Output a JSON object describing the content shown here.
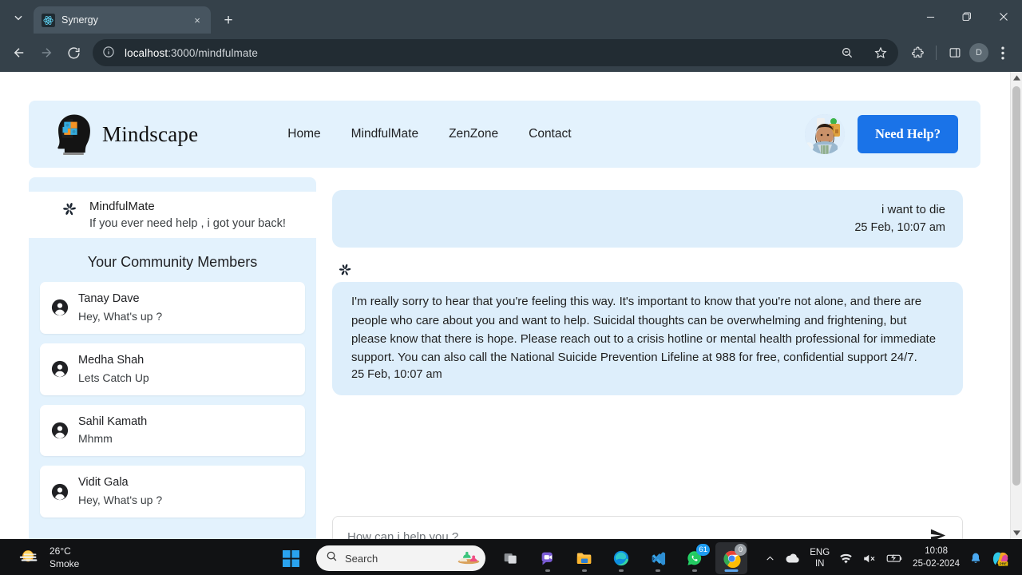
{
  "browser": {
    "tab": {
      "title": "Synergy",
      "favicon": "react-atom-icon",
      "close": "×"
    },
    "new_tab": "+",
    "window_controls": {
      "minimize": "−",
      "restore": "❐",
      "close": "✕"
    },
    "omnibox": {
      "host": "localhost",
      "rest": ":3000/mindfulmate",
      "info_icon": "site-info-icon"
    },
    "profile_initial": "D"
  },
  "site": {
    "brand": "Mindscape",
    "nav": [
      {
        "label": "Home"
      },
      {
        "label": "MindfulMate"
      },
      {
        "label": "ZenZone"
      },
      {
        "label": "Contact"
      }
    ],
    "need_help_label": "Need Help?",
    "accent_color": "#1a73e8",
    "panel_color": "#e3f2fd",
    "bubble_color": "#ddeefb"
  },
  "sidebar": {
    "assistant": {
      "name": "MindfulMate",
      "tagline": "If you ever need help , i got your back!",
      "icon": "pinwheel-sparkle-icon"
    },
    "members_title": "Your Community Members",
    "members": [
      {
        "name": "Tanay Dave",
        "message": "Hey, What's up ?"
      },
      {
        "name": "Medha Shah",
        "message": "Lets Catch Up"
      },
      {
        "name": "Sahil Kamath",
        "message": "Mhmm"
      },
      {
        "name": "Vidit Gala",
        "message": "Hey, What's up ?"
      }
    ]
  },
  "chat": {
    "messages": [
      {
        "role": "user",
        "text": "i want to die",
        "timestamp": "25 Feb, 10:07 am"
      },
      {
        "role": "assistant",
        "text": "I'm really sorry to hear that you're feeling this way. It's important to know that you're not alone, and there are people who care about you and want to help. Suicidal thoughts can be overwhelming and frightening, but please know that there is hope. Please reach out to a crisis hotline or mental health professional for immediate support. You can also call the National Suicide Prevention Lifeline at 988 for free, confidential support 24/7.",
        "timestamp": "25 Feb, 10:07 am"
      }
    ],
    "composer": {
      "placeholder": "How can i help you ?",
      "value": "",
      "send_icon": "send-paper-plane-icon"
    }
  },
  "taskbar": {
    "weather": {
      "temperature": "26°C",
      "condition": "Smoke",
      "icon": "haze-sun-icon"
    },
    "search_placeholder": "Search",
    "apps": [
      {
        "name": "task-view"
      },
      {
        "name": "chat-video"
      },
      {
        "name": "file-explorer"
      },
      {
        "name": "microsoft-edge"
      },
      {
        "name": "vs-code"
      },
      {
        "name": "whatsapp",
        "badge": "61"
      },
      {
        "name": "google-chrome",
        "badge": "0"
      }
    ],
    "tray": {
      "language": "ENG",
      "region": "IN",
      "time": "10:08",
      "date": "25-02-2024",
      "copilot_label": "PRE"
    }
  }
}
